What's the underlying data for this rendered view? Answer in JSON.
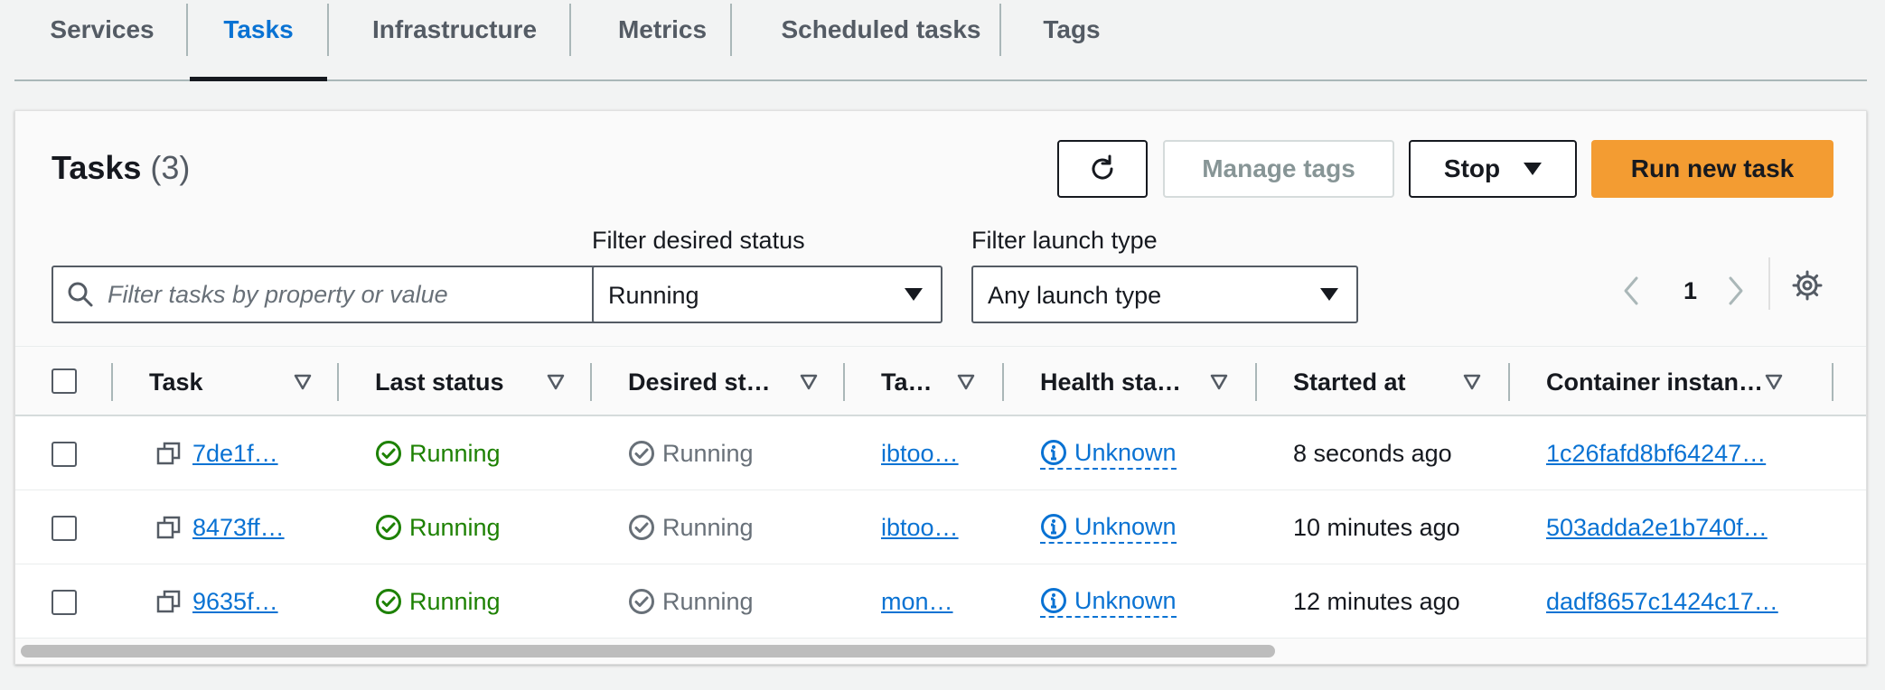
{
  "tabs": [
    "Services",
    "Tasks",
    "Infrastructure",
    "Metrics",
    "Scheduled tasks",
    "Tags"
  ],
  "panel": {
    "title": "Tasks",
    "count": "(3)"
  },
  "buttons": {
    "manage_tags": "Manage tags",
    "stop": "Stop",
    "run_new_task": "Run new task"
  },
  "search": {
    "placeholder": "Filter tasks by property or value"
  },
  "filters": {
    "desired_status_label": "Filter desired status",
    "desired_status_value": "Running",
    "launch_type_label": "Filter launch type",
    "launch_type_value": "Any launch type"
  },
  "pagination": {
    "page": "1"
  },
  "table": {
    "columns": [
      "Task",
      "Last status",
      "Desired st…",
      "Ta…",
      "Health sta…",
      "Started at",
      "Container instan…"
    ],
    "rows": [
      {
        "task": "7de1f…",
        "last_status": "Running",
        "desired_status": "Running",
        "task_def": "ibtoo…",
        "health": "Unknown",
        "started": "8 seconds ago",
        "container": "1c26fafd8bf64247…"
      },
      {
        "task": "8473ff…",
        "last_status": "Running",
        "desired_status": "Running",
        "task_def": "ibtoo…",
        "health": "Unknown",
        "started": "10 minutes ago",
        "container": "503adda2e1b740f…"
      },
      {
        "task": "9635f…",
        "last_status": "Running",
        "desired_status": "Running",
        "task_def": "mon…",
        "health": "Unknown",
        "started": "12 minutes ago",
        "container": "dadf8657c1424c17…"
      }
    ]
  },
  "colors": {
    "link": "#0972d3",
    "success": "#1d8102",
    "primary_button": "#f39c32"
  }
}
